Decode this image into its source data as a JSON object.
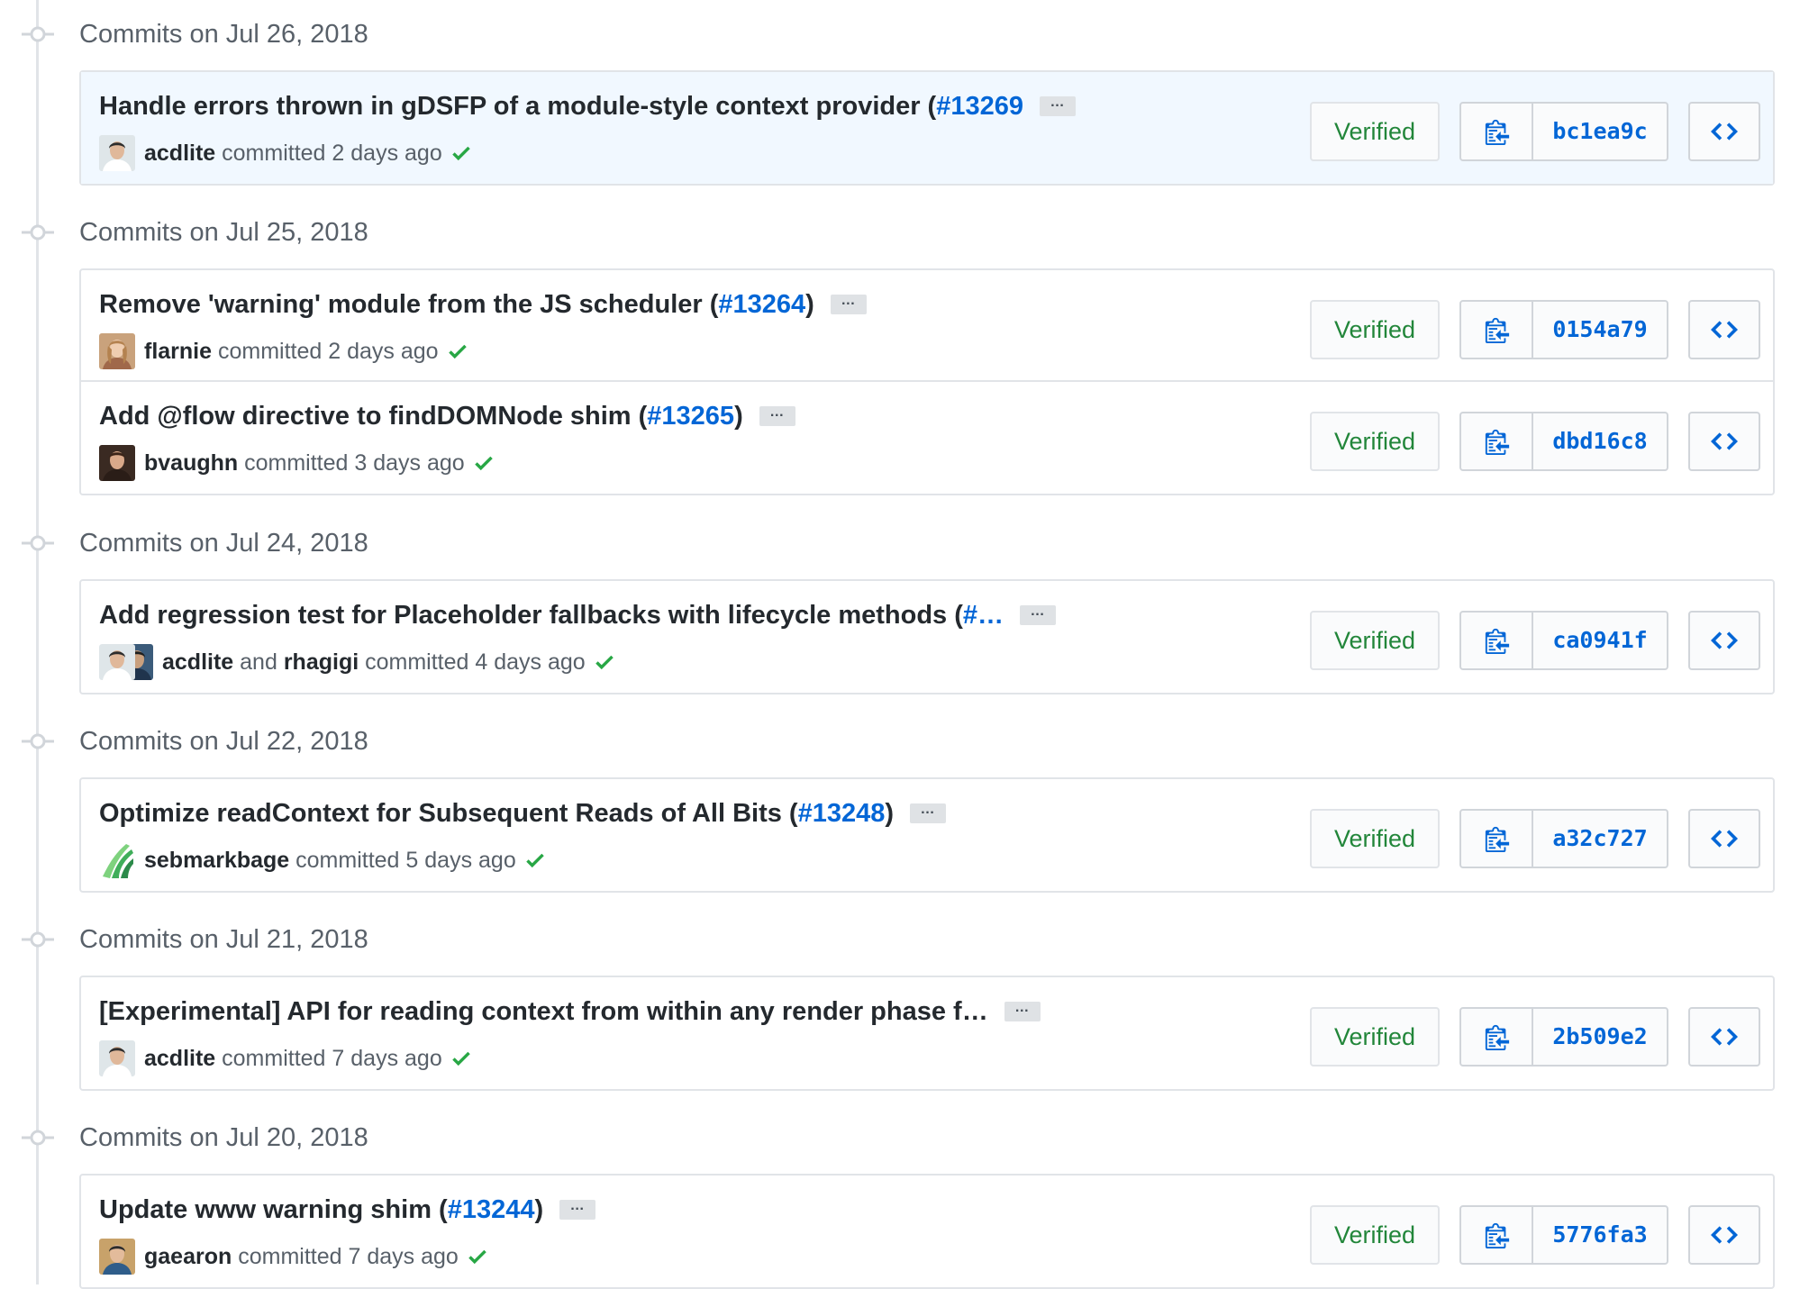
{
  "groups": [
    {
      "date": "Commits on Jul 26, 2018",
      "commits": [
        {
          "message": "Handle errors thrown in gDSFP of a module-style context provider (",
          "pr": "#13269",
          "suffix": "",
          "expand": "…",
          "authors": [
            "acdlite"
          ],
          "joiner": "",
          "action": "committed 2 days ago",
          "verified": "Verified",
          "sha": "bc1ea9c",
          "highlighted": true
        }
      ]
    },
    {
      "date": "Commits on Jul 25, 2018",
      "commits": [
        {
          "message": "Remove 'warning' module from the JS scheduler (",
          "pr": "#13264",
          "suffix": ")",
          "expand": "…",
          "authors": [
            "flarnie"
          ],
          "joiner": "",
          "action": "committed 2 days ago",
          "verified": "Verified",
          "sha": "0154a79",
          "highlighted": false
        },
        {
          "message": "Add @flow directive to findDOMNode shim (",
          "pr": "#13265",
          "suffix": ")",
          "expand": "…",
          "authors": [
            "bvaughn"
          ],
          "joiner": "",
          "action": "committed 3 days ago",
          "verified": "Verified",
          "sha": "dbd16c8",
          "highlighted": false
        }
      ]
    },
    {
      "date": "Commits on Jul 24, 2018",
      "commits": [
        {
          "message": "Add regression test for Placeholder fallbacks with lifecycle methods (",
          "pr": "#…",
          "suffix": "",
          "expand": "…",
          "authors": [
            "acdlite",
            "rhagigi"
          ],
          "joiner": "and",
          "action": "committed 4 days ago",
          "verified": "Verified",
          "sha": "ca0941f",
          "highlighted": false
        }
      ]
    },
    {
      "date": "Commits on Jul 22, 2018",
      "commits": [
        {
          "message": "Optimize readContext for Subsequent Reads of All Bits (",
          "pr": "#13248",
          "suffix": ")",
          "expand": "…",
          "authors": [
            "sebmarkbage"
          ],
          "joiner": "",
          "action": "committed 5 days ago",
          "verified": "Verified",
          "sha": "a32c727",
          "highlighted": false
        }
      ]
    },
    {
      "date": "Commits on Jul 21, 2018",
      "commits": [
        {
          "message": "[Experimental] API for reading context from within any render phase f…",
          "pr": "",
          "suffix": "",
          "expand": "…",
          "authors": [
            "acdlite"
          ],
          "joiner": "",
          "action": "committed 7 days ago",
          "verified": "Verified",
          "sha": "2b509e2",
          "highlighted": false
        }
      ]
    },
    {
      "date": "Commits on Jul 20, 2018",
      "commits": [
        {
          "message": "Update www warning shim (",
          "pr": "#13244",
          "suffix": ")",
          "expand": "…",
          "authors": [
            "gaearon"
          ],
          "joiner": "",
          "action": "committed 7 days ago",
          "verified": "Verified",
          "sha": "5776fa3",
          "highlighted": false
        }
      ]
    }
  ],
  "icons": {
    "timeline_node": "commit-node-icon",
    "status": "check-icon",
    "copy": "clipboard-icon",
    "browse": "code-icon"
  },
  "colors": {
    "link": "#0366d6",
    "verified": "#22863a",
    "check": "#28a745",
    "highlight_bg": "#f1f8ff",
    "border": "#e1e4e8"
  }
}
